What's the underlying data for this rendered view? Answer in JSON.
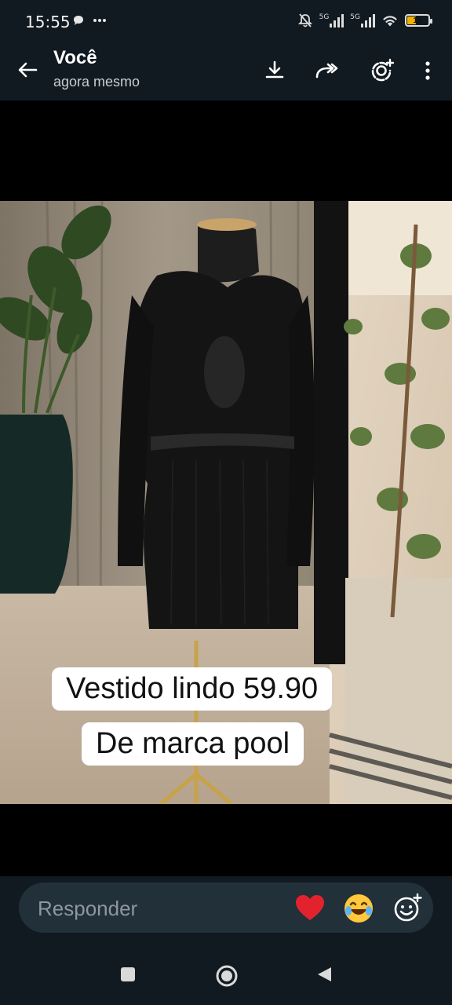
{
  "status_bar": {
    "time": "15:55",
    "network_1": "5G",
    "network_2": "5G",
    "battery_level": "15",
    "icons": [
      "chat-bubble-icon",
      "more-dots-icon",
      "mute-icon",
      "signal-icon",
      "wifi-icon",
      "battery-icon"
    ]
  },
  "header": {
    "title": "Você",
    "subtitle": "agora mesmo",
    "actions": [
      "download-icon",
      "forward-icon",
      "status-add-icon",
      "more-vert-icon"
    ]
  },
  "media": {
    "caption_line_1": "Vestido lindo 59.90",
    "caption_line_2": "De marca pool"
  },
  "reply": {
    "placeholder": "Responder",
    "reactions": [
      "heart-icon",
      "laughing-emoji-icon",
      "add-emoji-icon"
    ]
  },
  "colors": {
    "bar_bg": "#111a21",
    "input_bg": "#22303a",
    "heart": "#e2232e",
    "emoji_yellow": "#ffc83d",
    "battery": "#f1b000"
  }
}
